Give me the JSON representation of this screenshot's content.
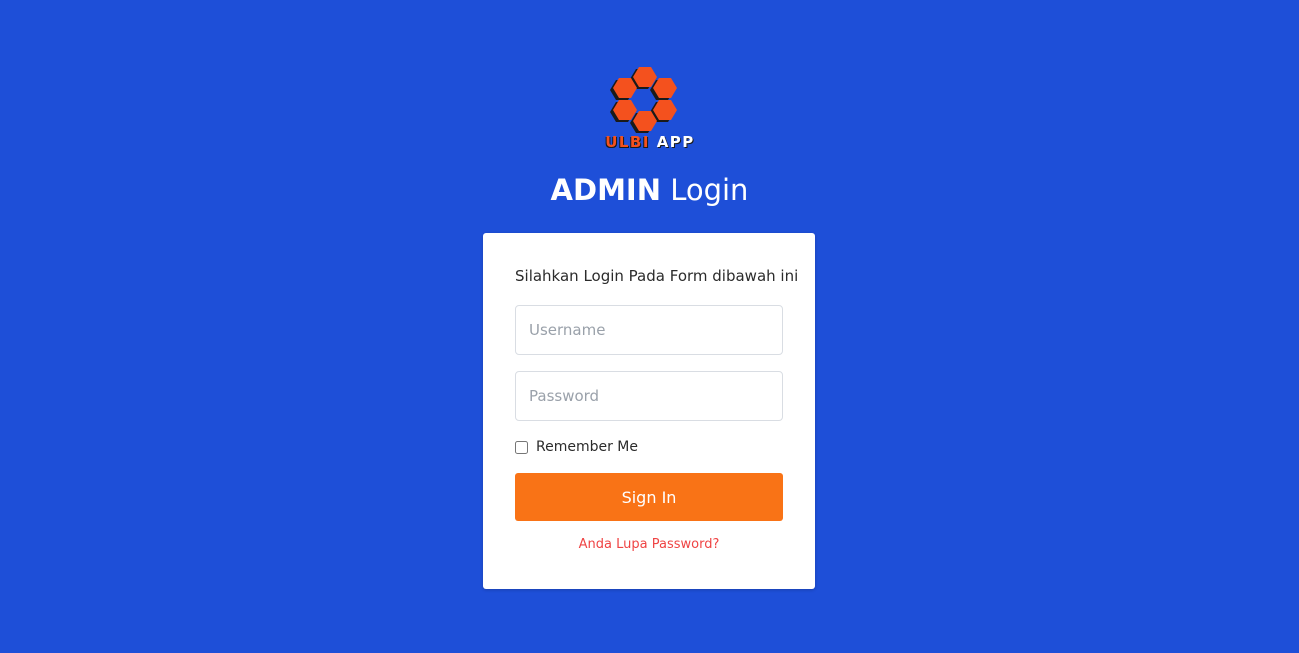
{
  "logo": {
    "text_part1": "ULBI",
    "text_part2": "APP",
    "icon": "honeycomb-flower-logo",
    "color": "#f4511e"
  },
  "header": {
    "title_bold": "ADMIN",
    "title_light": "Login"
  },
  "form": {
    "instruction": "Silahkan Login Pada Form dibawah ini",
    "username_placeholder": "Username",
    "password_placeholder": "Password",
    "remember_label": "Remember Me",
    "signin_label": "Sign In",
    "forgot_label": "Anda Lupa Password?"
  },
  "colors": {
    "background": "#1e4fd8",
    "button": "#f97316",
    "link": "#ef4444"
  }
}
